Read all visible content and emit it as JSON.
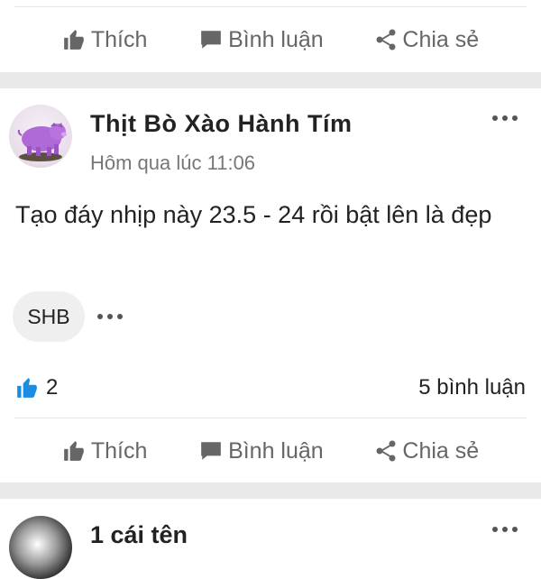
{
  "actions": {
    "like_label": "Thích",
    "comment_label": "Bình luận",
    "share_label": "Chia sẻ"
  },
  "post": {
    "author": "Thịt Bò Xào Hành Tím",
    "time": "Hôm qua lúc 11:06",
    "text": "Tạo đáy nhịp này 23.5 - 24 rồi bật lên là đẹp",
    "tag": "SHB",
    "like_count": "2",
    "comment_count": "5 bình luận"
  },
  "next_post": {
    "author": "1 cái tên"
  },
  "colors": {
    "like_blue": "#1877f2",
    "muted_icon": "#666666",
    "separator": "#e9e9e9"
  },
  "icons": [
    "thumbs-up-icon",
    "comment-icon",
    "share-icon",
    "more-icon"
  ]
}
